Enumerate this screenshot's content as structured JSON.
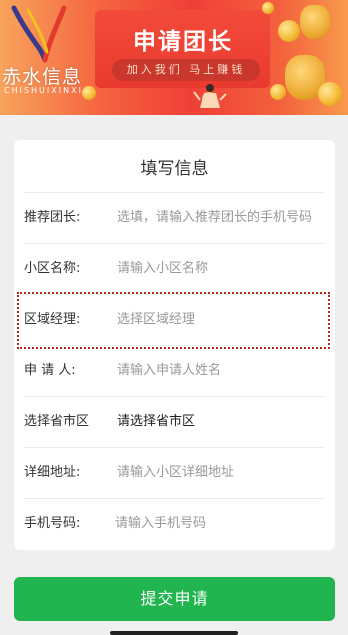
{
  "banner": {
    "title": "申请团长",
    "subtitle": "加入我们 马上赚钱",
    "logo_text_cn": "赤水信息",
    "logo_text_en": "CHISHUIXINXI"
  },
  "form": {
    "title": "填写信息",
    "fields": [
      {
        "label": "推荐团长:",
        "value": "选填，请输入推荐团长的手机号码"
      },
      {
        "label": "小区名称:",
        "value": "请输入小区名称"
      },
      {
        "label": "区域经理:",
        "value": "选择区域经理"
      },
      {
        "label": "申 请 人:",
        "value": "请输入申请人姓名"
      },
      {
        "label": "选择省市区",
        "value": "请选择省市区"
      },
      {
        "label": "详细地址:",
        "value": "请输入小区详细地址"
      },
      {
        "label": "手机号码:",
        "value": "请输入手机号码"
      }
    ]
  },
  "submit_label": "提交申请",
  "colors": {
    "submit": "#21b54f",
    "banner_red": "#ef3f37",
    "highlight_border": "#b2261f"
  }
}
